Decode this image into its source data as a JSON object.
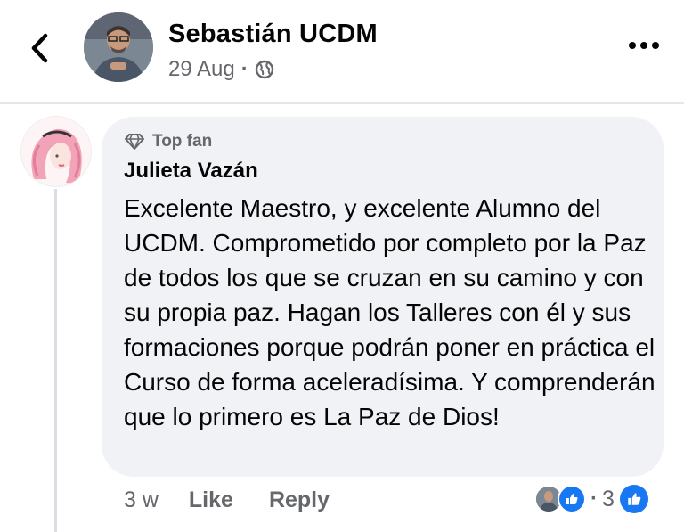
{
  "header": {
    "author_name": "Sebastián UCDM",
    "date": "29 Aug",
    "separator": "·",
    "back_icon": "chevron-left-icon",
    "more_icon": "more-horizontal-icon",
    "audience_icon": "globe-icon"
  },
  "comment": {
    "badge_label": "Top fan",
    "badge_icon": "diamond-icon",
    "author": "Julieta Vazán",
    "text": "Excelente Maestro, y excelente Alumno del UCDM. Comprometido por completo por la Paz de todos los que se cruzan en su camino y con su propia paz. Hagan los Talleres con él y sus formaciones porque podrán poner en práctica el Curso de forma aceleradísima. Y comprenderán que lo primero es La Paz de Dios!",
    "age": "3 w",
    "like_label": "Like",
    "reply_label": "Reply",
    "reaction_separator": "·",
    "reaction_count": "3"
  },
  "colors": {
    "bubble": "#f0f2f5",
    "secondary_text": "#65676b",
    "like_blue": "#1877f2"
  }
}
